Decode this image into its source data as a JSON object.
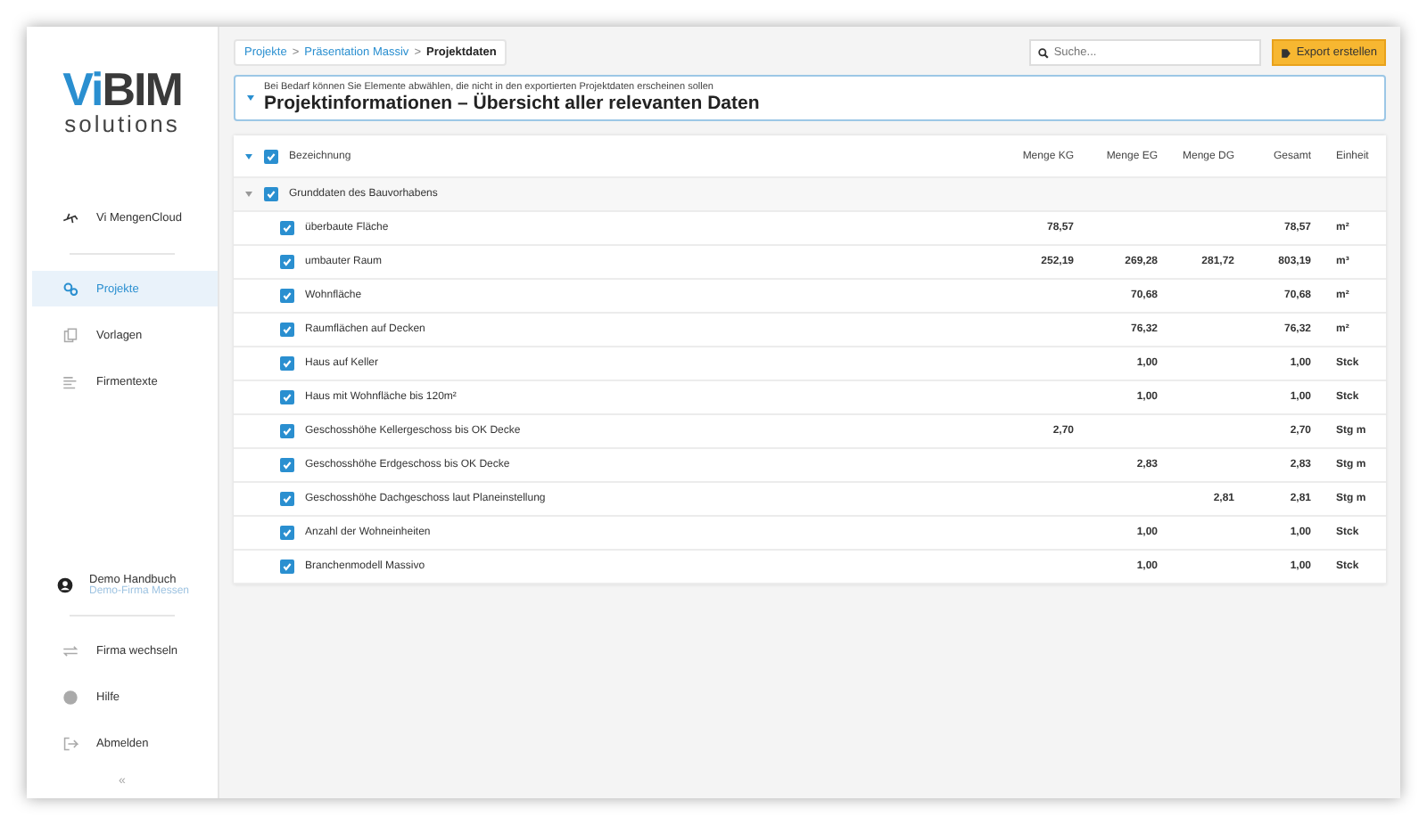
{
  "logo": {
    "accent": "Vi",
    "main": "BIM",
    "tagline": "solutions"
  },
  "sidebar": {
    "top_items": [
      {
        "label": "Vi MengenCloud",
        "selected": false
      }
    ],
    "items": [
      {
        "label": "Projekte",
        "selected": true
      },
      {
        "label": "Vorlagen",
        "selected": false
      },
      {
        "label": "Firmentexte",
        "selected": false
      }
    ],
    "user": {
      "name": "Demo Handbuch",
      "company": "Demo-Firma Messen"
    },
    "bottom_items": [
      {
        "label": "Firma wechseln"
      },
      {
        "label": "Hilfe"
      },
      {
        "label": "Abmelden"
      }
    ],
    "collapse": "«"
  },
  "breadcrumb": [
    {
      "label": "Projekte",
      "current": false
    },
    {
      "label": "Präsentation Massiv",
      "current": false
    },
    {
      "label": "Projektdaten",
      "current": true
    }
  ],
  "breadcrumb_separator": ">",
  "search": {
    "placeholder": "Suche..."
  },
  "export_button": "Export erstellen",
  "info": {
    "hint": "Bei Bedarf können Sie Elemente abwählen, die nicht in den exportierten Projektdaten erscheinen sollen",
    "title": "Projektinformationen – Übersicht aller relevanten Daten",
    "expanded": true
  },
  "table": {
    "columns": [
      "Bezeichnung",
      "Menge KG",
      "Menge EG",
      "Menge DG",
      "Gesamt",
      "Einheit"
    ],
    "header_checked": true,
    "group": {
      "label": "Grunddaten des Bauvorhabens",
      "checked": true,
      "expanded": true
    },
    "rows": [
      {
        "checked": true,
        "cells": [
          "überbaute Fläche",
          "78,57",
          "",
          "",
          "78,57",
          "m²"
        ]
      },
      {
        "checked": true,
        "cells": [
          "umbauter Raum",
          "252,19",
          "269,28",
          "281,72",
          "803,19",
          "m³"
        ]
      },
      {
        "checked": true,
        "cells": [
          "Wohnfläche",
          "",
          "70,68",
          "",
          "70,68",
          "m²"
        ]
      },
      {
        "checked": true,
        "cells": [
          "Raumflächen auf Decken",
          "",
          "76,32",
          "",
          "76,32",
          "m²"
        ]
      },
      {
        "checked": true,
        "cells": [
          "Haus auf Keller",
          "",
          "1,00",
          "",
          "1,00",
          "Stck"
        ]
      },
      {
        "checked": true,
        "cells": [
          "Haus mit Wohnfläche bis 120m²",
          "",
          "1,00",
          "",
          "1,00",
          "Stck"
        ]
      },
      {
        "checked": true,
        "cells": [
          "Geschosshöhe Kellergeschoss bis OK Decke",
          "2,70",
          "",
          "",
          "2,70",
          "Stg m"
        ]
      },
      {
        "checked": true,
        "cells": [
          "Geschosshöhe Erdgeschoss bis OK Decke",
          "",
          "2,83",
          "",
          "2,83",
          "Stg m"
        ]
      },
      {
        "checked": true,
        "cells": [
          "Geschosshöhe Dachgeschoss laut Planeinstellung",
          "",
          "",
          "2,81",
          "2,81",
          "Stg m"
        ]
      },
      {
        "checked": true,
        "cells": [
          "Anzahl der Wohneinheiten",
          "",
          "1,00",
          "",
          "1,00",
          "Stck"
        ]
      },
      {
        "checked": true,
        "cells": [
          "Branchenmodell Massivo",
          "",
          "1,00",
          "",
          "1,00",
          "Stck"
        ]
      }
    ]
  }
}
